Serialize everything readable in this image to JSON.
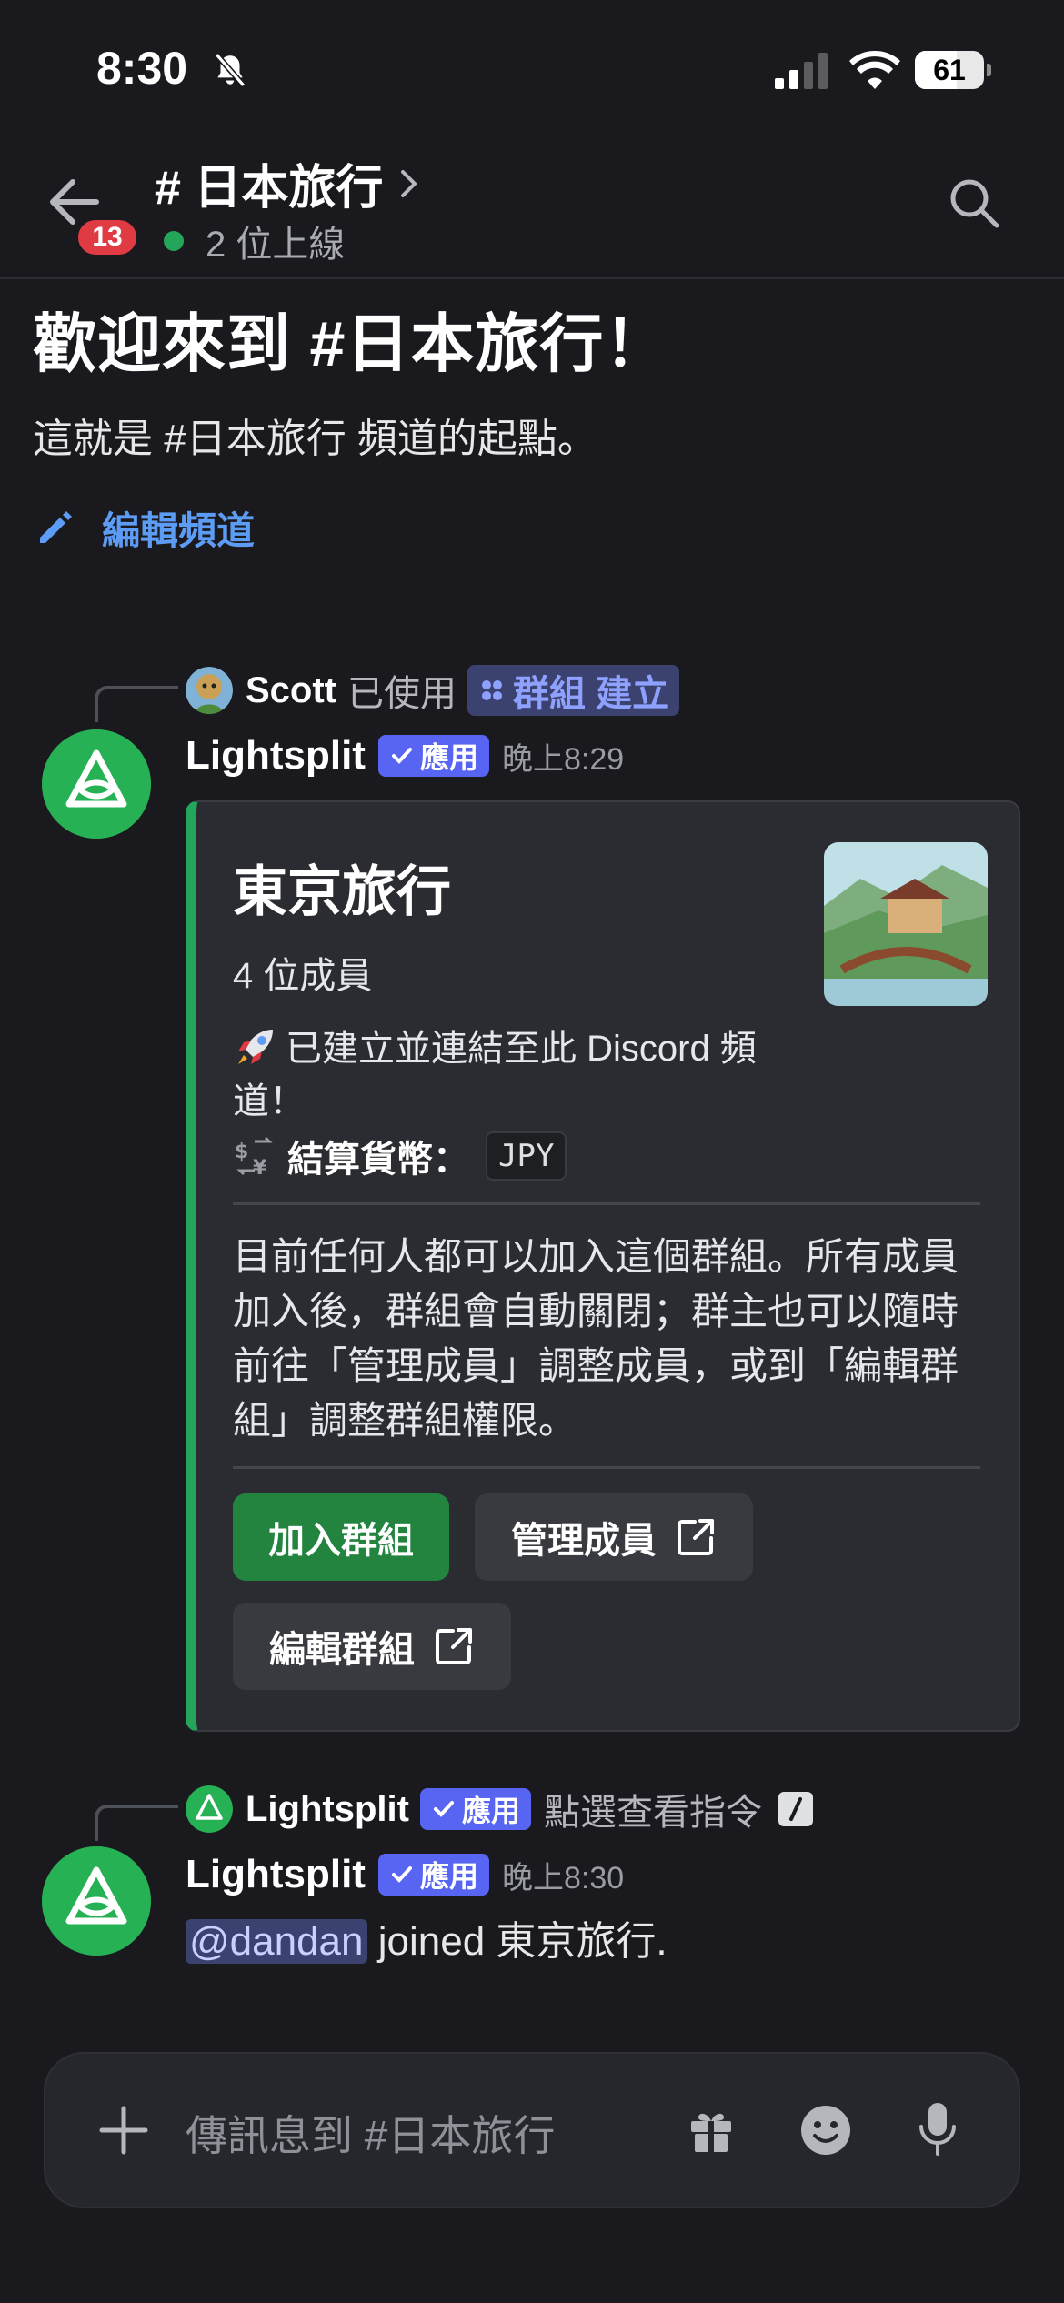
{
  "status_bar": {
    "time": "8:30",
    "battery": "61",
    "icons": [
      "bell-slash-icon",
      "signal-icon",
      "wifi-icon",
      "battery-icon"
    ]
  },
  "header": {
    "badge_count": "13",
    "channel_title": "# 日本旅行",
    "online_text": "2 位上線",
    "icons": [
      "arrow-left-icon",
      "chevron-right-icon",
      "search-icon"
    ]
  },
  "welcome": {
    "title": "歡迎來到 #日本旅行！",
    "subtitle": "這就是 #日本旅行 頻道的起點。",
    "edit_channel": "編輯頻道"
  },
  "message1": {
    "reply_user": "Scott",
    "reply_used": "已使用",
    "reply_command": "群組 建立",
    "author": "Lightsplit",
    "app_tag": "應用",
    "timestamp": "晚上8:29"
  },
  "embed": {
    "title": "東京旅行",
    "members": "4 位成員",
    "created": "已建立並連結至此 Discord 頻道！",
    "currency_label": "結算貨幣：",
    "currency_code": "JPY",
    "description": "目前任何人都可以加入這個群組。所有成員加入後，群組會自動關閉；群主也可以隨時前往「管理成員」調整成員，或到「編輯群組」調整群組權限。",
    "buttons": {
      "join": "加入群組",
      "manage": "管理成員",
      "edit": "編輯群組"
    },
    "accent_color": "#23a55a"
  },
  "message2": {
    "reply_user": "Lightsplit",
    "reply_app_tag": "應用",
    "reply_text": "點選查看指令",
    "author": "Lightsplit",
    "app_tag": "應用",
    "timestamp": "晚上8:30",
    "mention": "@dandan",
    "body_joined": " joined ",
    "body_target": "東京旅行."
  },
  "composer": {
    "placeholder": "傳訊息到 #日本旅行",
    "icons": [
      "plus-icon",
      "gift-icon",
      "emoji-icon",
      "microphone-icon"
    ]
  },
  "colors": {
    "background": "#1a1a1e",
    "brand": "#5865f2",
    "online": "#23a55a",
    "link": "#5d9cf5",
    "danger": "#e03b42"
  }
}
